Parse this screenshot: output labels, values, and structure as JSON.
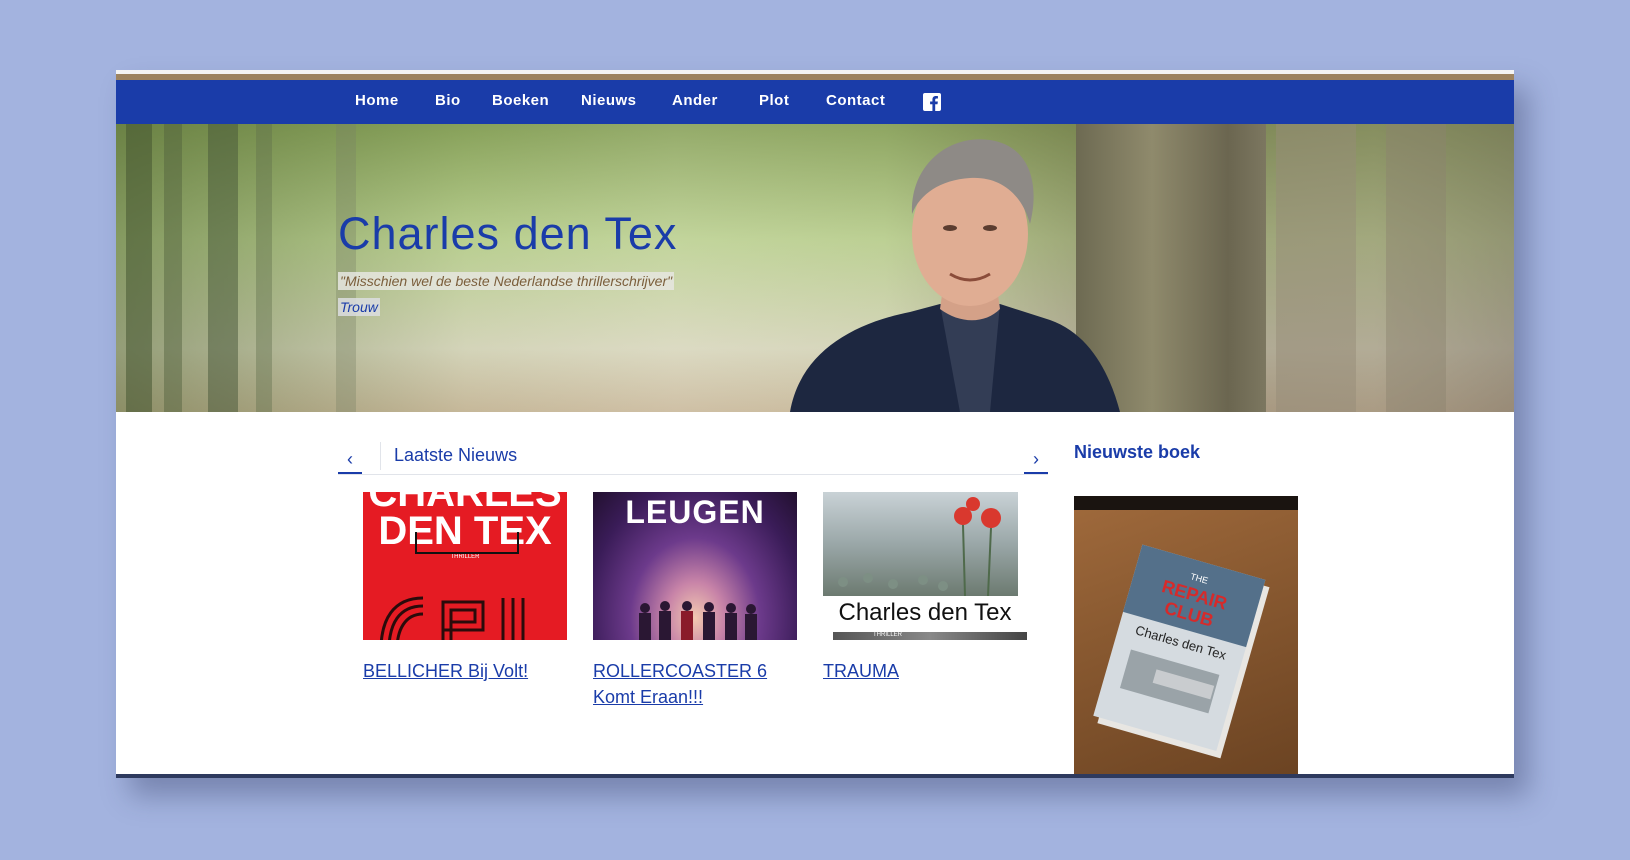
{
  "nav": {
    "items": [
      {
        "label": "Home"
      },
      {
        "label": "Bio"
      },
      {
        "label": "Boeken"
      },
      {
        "label": "Nieuws"
      },
      {
        "label": "Ander"
      },
      {
        "label": "Plot"
      },
      {
        "label": "Contact"
      }
    ],
    "social_icon": "facebook-icon"
  },
  "hero": {
    "title": "Charles den Tex",
    "quote": "\"Misschien wel de beste Nederlandse thrillerschrijver\"",
    "source": "Trouw"
  },
  "news": {
    "heading": "Laatste Nieuws",
    "prev_icon": "chevron-left-icon",
    "next_icon": "chevron-right-icon",
    "prev_glyph": "‹",
    "next_glyph": "›",
    "items": [
      {
        "title": "BELLICHER Bij Volt!",
        "cover_text": [
          "CHARLES",
          "DEN TEX"
        ],
        "cover_label": "THRILLER"
      },
      {
        "title": "ROLLERCOASTER 6 Komt Eraan!!!",
        "cover_text": [
          "LEUGEN"
        ]
      },
      {
        "title": "TRAUMA",
        "cover_text": [
          "Charles den Tex"
        ],
        "cover_label": "THRILLER"
      }
    ]
  },
  "book": {
    "heading": "Nieuwste boek",
    "cover_title": [
      "THE",
      "REPAIR",
      "CLUB"
    ],
    "cover_author": "Charles den Tex"
  },
  "colors": {
    "brand_blue": "#1a3ca9",
    "accent_brown": "#9d8360",
    "page_bg": "#a3b3df"
  }
}
